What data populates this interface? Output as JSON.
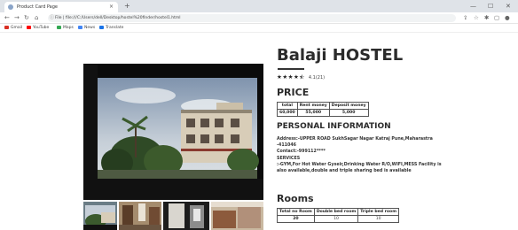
{
  "browser": {
    "tab_title": "Product Card Page",
    "tab_close": "×",
    "new_tab": "+",
    "url": "File | file:///C:/Users/dell/Desktop/hostel%20finder/hostel1.html",
    "bookmarks": [
      {
        "label": "Gmail",
        "color": "#d93025"
      },
      {
        "label": "YouTube",
        "color": "#ff0000"
      },
      {
        "label": "Maps",
        "color": "#34a853"
      },
      {
        "label": "News",
        "color": "#4285f4"
      },
      {
        "label": "Translate",
        "color": "#1a73e8"
      }
    ]
  },
  "hostel": {
    "name": "Balaji HOSTEL",
    "stars": "★★★★⯪",
    "rating_text": "4.1(21)"
  },
  "price": {
    "heading": "PRICE",
    "headers": [
      "total",
      "Rent money",
      "Deposit money"
    ],
    "values": [
      "60,000",
      "55,000",
      "5,000"
    ]
  },
  "personal": {
    "heading": "PERSONAL INFORMATION",
    "address": "Address:-UPPER ROAD SukhSagar Nagar Katraj Pune,Maharastra -411046",
    "contact": "Contact:-999112****",
    "services_label": "SERVICES",
    "services": ":-GYM,For Hot Water Gyseir,Drinking Water R/O,WIFI,MESS Facility is also available,double and triple sharing bed is available"
  },
  "rooms": {
    "heading": "Rooms",
    "headers": [
      "Total no Room",
      "Double bed room",
      "Triple bed room"
    ],
    "values": [
      "20",
      "10",
      "10"
    ]
  },
  "colors": {
    "title": "#2b2b2b",
    "chrome": "#dfe3e8"
  }
}
